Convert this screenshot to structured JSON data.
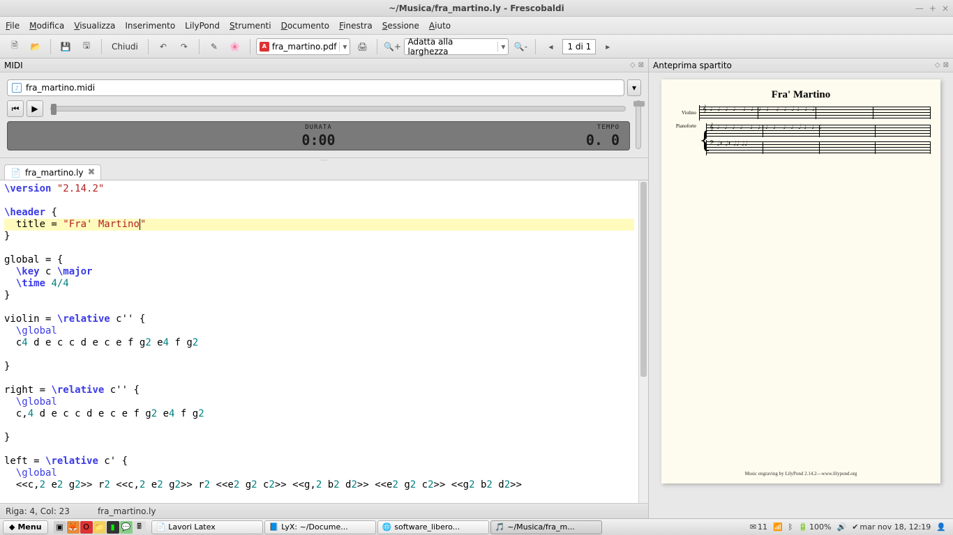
{
  "window": {
    "title": "~/Musica/fra_martino.ly - Frescobaldi"
  },
  "menubar": [
    "File",
    "Modifica",
    "Visualizza",
    "Inserimento",
    "LilyPond",
    "Strumenti",
    "Documento",
    "Finestra",
    "Sessione",
    "Aiuto"
  ],
  "toolbar": {
    "close_label": "Chiudi",
    "pdf_name": "fra_martino.pdf",
    "zoom_label": "Adatta alla larghezza",
    "page_indicator": "1 di 1"
  },
  "midi": {
    "panel_title": "MIDI",
    "file": "fra_martino.midi",
    "durata_label": "DURATA",
    "tempo_label": "TEMPO",
    "time": "0:00",
    "tempo": "0. 0"
  },
  "editor_tab": {
    "filename": "fra_martino.ly"
  },
  "code": {
    "l1a": "\\version",
    "l1b": " ",
    "l1c": "\"2.14.2\"",
    "l3a": "\\header",
    "l3b": " {",
    "l4a": "  title = ",
    "l4b": "\"Fra' Martino",
    "l4c": "\"",
    "l5": "}",
    "l7a": "global = {",
    "l8a": "  ",
    "l8b": "\\key",
    "l8c": " c ",
    "l8d": "\\major",
    "l9a": "  ",
    "l9b": "\\time",
    "l9c": " ",
    "l9d": "4/4",
    "l10": "}",
    "l12a": "violin = ",
    "l12b": "\\relative",
    "l12c": " c'' {",
    "l13a": "  ",
    "l13b": "\\global",
    "l14a": "  c",
    "l14b": "4",
    "l14c": " d e c c d e c e f g",
    "l14d": "2",
    "l14e": " e",
    "l14f": "4",
    "l14g": " f g",
    "l14h": "2",
    "l16": "}",
    "l18a": "right = ",
    "l18b": "\\relative",
    "l18c": " c'' {",
    "l19a": "  ",
    "l19b": "\\global",
    "l20a": "  c,",
    "l20b": "4",
    "l20c": " d e c c d e c e f g",
    "l20d": "2",
    "l20e": " e",
    "l20f": "4",
    "l20g": " f g",
    "l20h": "2",
    "l22": "}",
    "l24a": "left = ",
    "l24b": "\\relative",
    "l24c": " c' {",
    "l25a": "  ",
    "l25b": "\\global",
    "l26a": "  <<c,",
    "l26b": "2",
    "l26c": " e",
    "l26d": "2",
    "l26e": " g",
    "l26f": "2",
    "l26g": ">> r",
    "l26h": "2",
    "l26i": " <<c,",
    "l26j": "2",
    "l26k": " e",
    "l26l": "2",
    "l26m": " g",
    "l26n": "2",
    "l26o": ">> r",
    "l26p": "2",
    "l26q": " <<e",
    "l26r": "2",
    "l26s": " g",
    "l26t": "2",
    "l26u": " c",
    "l26v": "2",
    "l26w": ">> <<g,",
    "l26x": "2",
    "l26y": " b",
    "l26z": "2",
    "l26aa": " d",
    "l26ab": "2",
    "l26ac": ">> <<e",
    "l26ad": "2",
    "l26ae": " g",
    "l26af": "2",
    "l26ag": " c",
    "l26ah": "2",
    "l26ai": ">> <<g",
    "l26aj": "2",
    "l26ak": " b",
    "l26al": "2",
    "l26am": " d",
    "l26an": "2",
    "l26ao": ">>"
  },
  "status": {
    "pos": "Riga: 4, Col: 23",
    "file": "fra_martino.ly"
  },
  "preview": {
    "panel_title": "Anteprima spartito",
    "score_title": "Fra' Martino",
    "instr1": "Violino",
    "instr2": "Pianoforte",
    "engraving": "Music engraving by LilyPond 2.14.2—www.lilypond.org"
  },
  "taskbar": {
    "menu": "Menu",
    "tasks": [
      {
        "icon": "📄",
        "label": "Lavori Latex"
      },
      {
        "icon": "📘",
        "label": "LyX: ~/Docume..."
      },
      {
        "icon": "🌐",
        "label": "software_libero..."
      },
      {
        "icon": "🎵",
        "label": "~/Musica/fra_m...",
        "active": true
      }
    ],
    "tray": {
      "mail": "11",
      "battery": "100%",
      "clock": "mar nov 18, 12:19"
    }
  }
}
